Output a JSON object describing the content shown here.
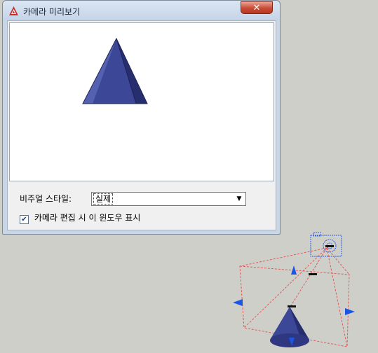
{
  "window": {
    "title": "카메라 미리보기",
    "close_label": "✕"
  },
  "controls": {
    "visual_style_label": "비주얼 스타일:",
    "visual_style_value": "실제",
    "show_window_label": "카메라 편집 시 이 윈도우 표시",
    "show_window_checked": true
  },
  "colors": {
    "cone_fill": "#3d4798",
    "camera_frustum": "#e25a5a",
    "camera_grip": "#1a55e6"
  }
}
